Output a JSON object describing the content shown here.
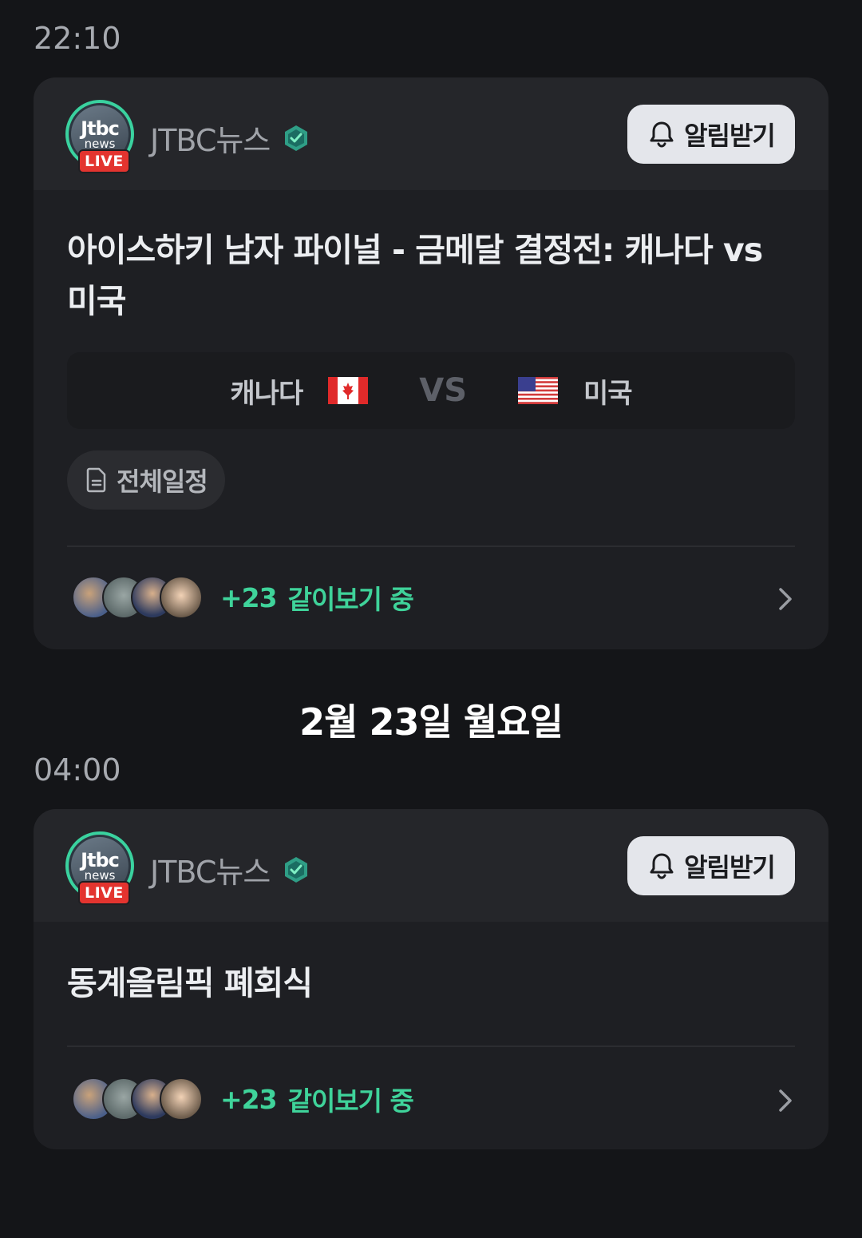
{
  "schedule": [
    {
      "time": "22:10",
      "channel": "JTBC뉴스",
      "logo_top": "Jtbc",
      "logo_bottom": "news",
      "live_badge": "LIVE",
      "notify_label": "알림받기",
      "title": "아이스하키 남자 파이널 - 금메달 결정전: 캐나다 vs 미국",
      "team_home": "캐나다",
      "vs": "VS",
      "team_away": "미국",
      "schedule_button": "전체일정",
      "watch_count": "+23",
      "watch_label": "같이보기 중"
    },
    {
      "time": "04:00",
      "channel": "JTBC뉴스",
      "logo_top": "Jtbc",
      "logo_bottom": "news",
      "live_badge": "LIVE",
      "notify_label": "알림받기",
      "title": "동계올림픽 폐회식",
      "watch_count": "+23",
      "watch_label": "같이보기 중"
    }
  ],
  "date_header": "2월 23일 월요일",
  "colors": {
    "background": "#141518",
    "card": "#1e1f23",
    "accent_green": "#3fd39a",
    "live_red": "#e3342f"
  },
  "icons": [
    "verified-badge-icon",
    "bell-icon",
    "canada-flag-icon",
    "usa-flag-icon",
    "document-icon",
    "chevron-right-icon"
  ]
}
